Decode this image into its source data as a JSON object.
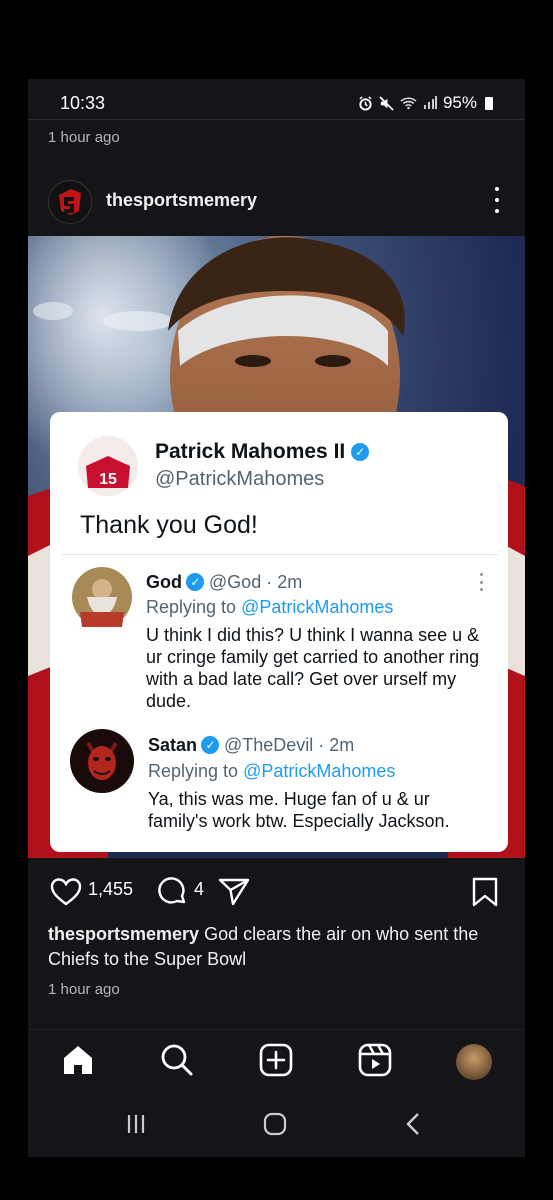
{
  "status_bar": {
    "time": "10:33",
    "battery": "95%"
  },
  "feed": {
    "previous_post_time": "1 hour ago"
  },
  "post": {
    "username": "thesportsmemery",
    "tweet": {
      "author_name": "Patrick Mahomes II",
      "author_handle": "@PatrickMahomes",
      "text": "Thank you God!",
      "jersey_number": "15",
      "replies": [
        {
          "name": "God",
          "handle_time": "@God · 2m",
          "replying_prefix": "Replying to",
          "replying_to": "@PatrickMahomes",
          "body": "U think I did this? U think I wanna see u & ur cringe family get carried to another ring with a bad late call? Get over urself my dude."
        },
        {
          "name": "Satan",
          "handle_time": "@TheDevil · 2m",
          "replying_prefix": "Replying to",
          "replying_to": "@PatrickMahomes",
          "body": "Ya, this was me. Huge fan of u & ur family's work btw. Especially Jackson."
        }
      ]
    },
    "likes": "1,455",
    "comments": "4",
    "caption_user": "thesportsmemery",
    "caption_text": "God clears the air on who sent the Chiefs to the Super Bowl",
    "time": "1 hour ago"
  },
  "icons": {
    "like": "heart-icon",
    "comment": "comment-icon",
    "share": "send-icon",
    "save": "bookmark-icon",
    "home": "home-icon",
    "search": "search-icon",
    "create": "plus-square-icon",
    "reels": "reels-icon"
  },
  "colors": {
    "background": "#141519",
    "link": "#1d9bf0",
    "verified": "#1d9bf0"
  }
}
